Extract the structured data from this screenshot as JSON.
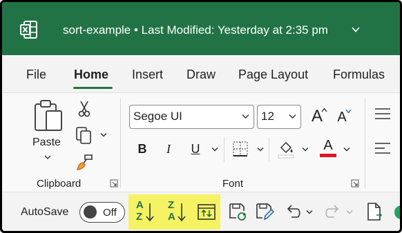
{
  "titlebar": {
    "app_icon": "excel-logo-icon",
    "title": "sort-example • Last Modified: Yesterday at 2:35 pm",
    "chevron_icon": "chevron-down-icon",
    "background": "#217346"
  },
  "tabs": [
    {
      "label": "File"
    },
    {
      "label": "Home",
      "active": true
    },
    {
      "label": "Insert"
    },
    {
      "label": "Draw"
    },
    {
      "label": "Page Layout"
    },
    {
      "label": "Formulas"
    }
  ],
  "ribbon": {
    "clipboard": {
      "paste_label": "Paste",
      "group_label": "Clipboard",
      "icons": [
        "paste-icon",
        "cut-icon",
        "copy-icon",
        "format-painter-icon"
      ]
    },
    "font": {
      "font_name": "Segoe UI",
      "font_size": "12",
      "group_label": "Font",
      "bold": "B",
      "italic": "I",
      "underline": "U",
      "font_color_glyph": "A",
      "grow_glyph": "A",
      "shrink_glyph": "A",
      "font_color_accent": "#e81123"
    }
  },
  "qat": {
    "autosave_label": "AutoSave",
    "toggle_state": "Off",
    "highlight_color": "#f5f264",
    "sort_icon_color": "#217346",
    "sort_az_glyph": [
      "A",
      "Z"
    ],
    "sort_za_glyph": [
      "Z",
      "A"
    ]
  }
}
